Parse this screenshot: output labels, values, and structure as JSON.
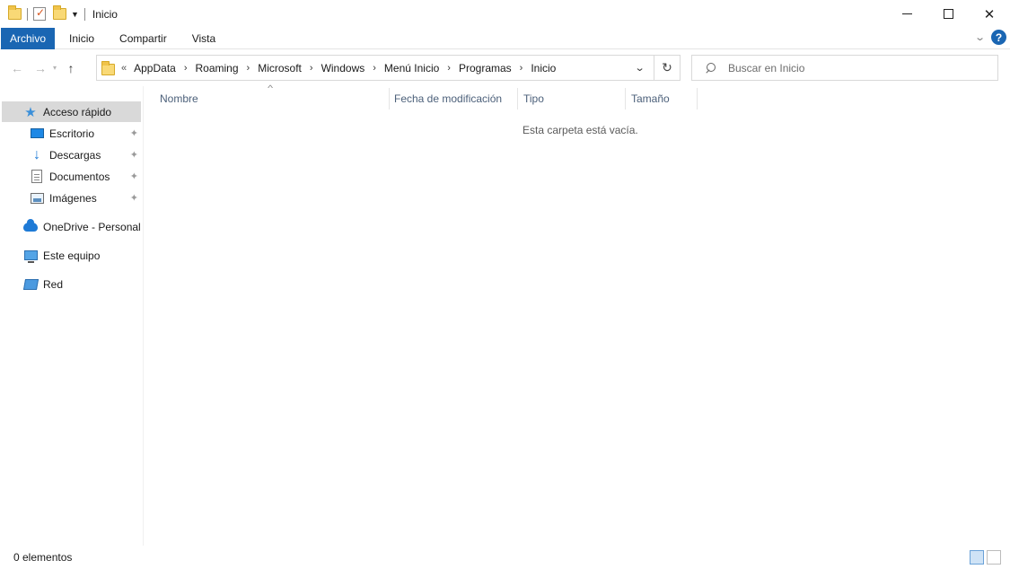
{
  "window": {
    "title": "Inicio",
    "controls": {
      "minimize": "minimize-icon",
      "maximize": "maximize-icon",
      "close": "✕"
    }
  },
  "ribbon": {
    "file_tab": "Archivo",
    "tabs": [
      "Inicio",
      "Compartir",
      "Vista"
    ],
    "help": "?",
    "accent": "#1a66b3"
  },
  "nav": {
    "back": "←",
    "forward": "→",
    "recent": "▾",
    "up": "↑"
  },
  "address": {
    "overflow": "«",
    "crumbs": [
      "AppData",
      "Roaming",
      "Microsoft",
      "Windows",
      "Menú Inicio",
      "Programas",
      "Inicio"
    ],
    "separator": "›",
    "dropdown": "⌄",
    "refresh": "↻"
  },
  "search": {
    "placeholder": "Buscar en Inicio"
  },
  "sidebar": {
    "quick_access": {
      "label": "Acceso rápido",
      "icon": "star-icon"
    },
    "pinned": [
      {
        "label": "Escritorio",
        "icon": "desktop-icon"
      },
      {
        "label": "Descargas",
        "icon": "download-icon"
      },
      {
        "label": "Documentos",
        "icon": "documents-icon"
      },
      {
        "label": "Imágenes",
        "icon": "pictures-icon"
      }
    ],
    "locations": [
      {
        "label": "OneDrive - Personal",
        "icon": "onedrive-icon"
      },
      {
        "label": "Este equipo",
        "icon": "computer-icon"
      },
      {
        "label": "Red",
        "icon": "network-icon"
      }
    ],
    "pin_glyph": "📌"
  },
  "columns": [
    "Nombre",
    "Fecha de modificación",
    "Tipo",
    "Tamaño"
  ],
  "empty_message": "Esta carpeta está vacía.",
  "status": {
    "items": "0 elementos"
  }
}
